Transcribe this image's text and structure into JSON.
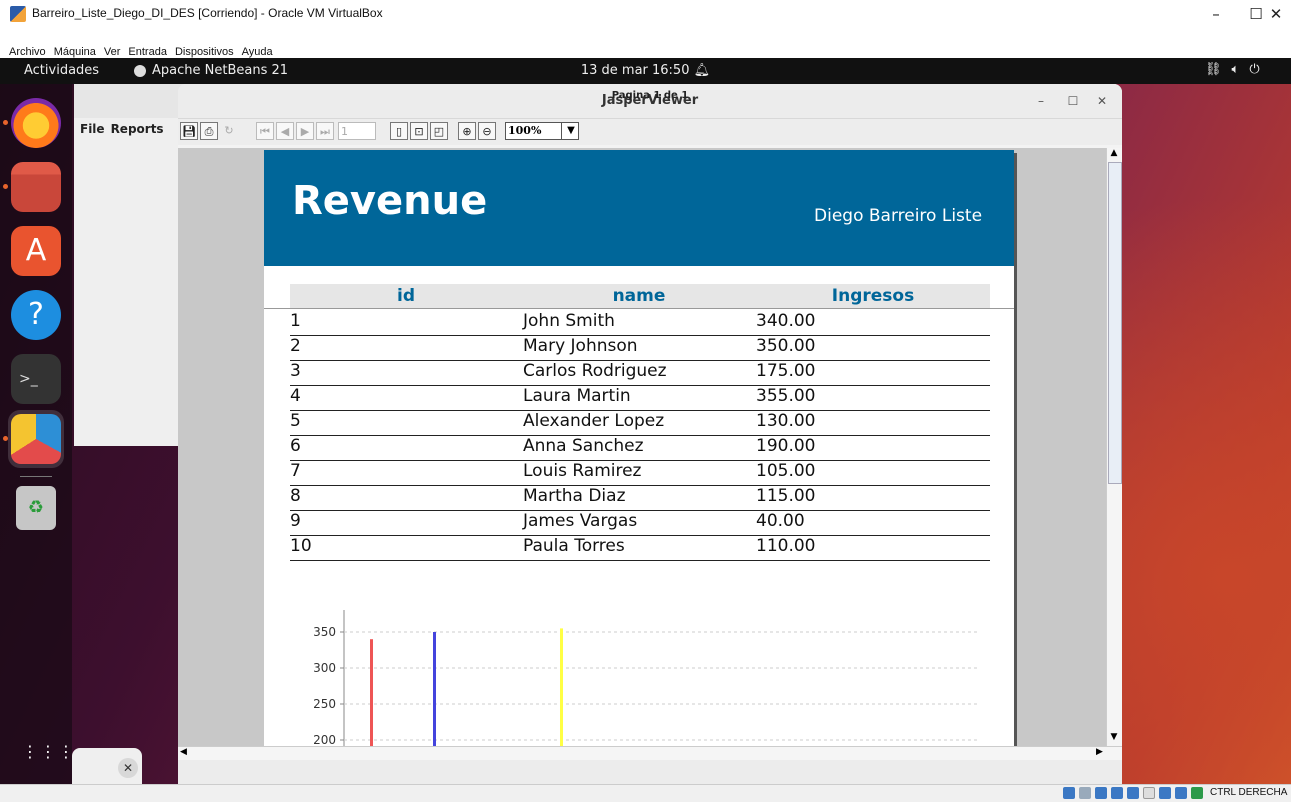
{
  "host": {
    "title": "Barreiro_Liste_Diego_DI_DES [Corriendo] - Oracle VM VirtualBox",
    "menus": [
      "Archivo",
      "Máquina",
      "Ver",
      "Entrada",
      "Dispositivos",
      "Ayuda"
    ],
    "statusbar_label": "CTRL DERECHA"
  },
  "gnome": {
    "activities": "Actividades",
    "app_name": "Apache NetBeans 21",
    "clock": "13 de mar  16:50"
  },
  "netbeans": {
    "menus": [
      "File",
      "Reports"
    ]
  },
  "viewer": {
    "title": "JasperViewer",
    "page_field": "1",
    "zoom": "100%",
    "status": "Pagina 1 de 1"
  },
  "report": {
    "title": "Revenue",
    "author": "Diego Barreiro Liste",
    "columns": [
      "id",
      "name",
      "Ingresos"
    ],
    "rows": [
      [
        "1",
        "John Smith",
        "340.00"
      ],
      [
        "2",
        "Mary Johnson",
        "350.00"
      ],
      [
        "3",
        "Carlos Rodriguez",
        "175.00"
      ],
      [
        "4",
        "Laura Martin",
        "355.00"
      ],
      [
        "5",
        "Alexander Lopez",
        "130.00"
      ],
      [
        "6",
        "Anna Sanchez",
        "190.00"
      ],
      [
        "7",
        "Louis Ramirez",
        "105.00"
      ],
      [
        "8",
        "Martha Diaz",
        "115.00"
      ],
      [
        "9",
        "James Vargas",
        "40.00"
      ],
      [
        "10",
        "Paula Torres",
        "110.00"
      ]
    ]
  },
  "chart_data": {
    "type": "bar",
    "title": "",
    "xlabel": "",
    "ylabel": "",
    "y_ticks": [
      200,
      250,
      300,
      350
    ],
    "ylim": [
      200,
      360
    ],
    "visible_bars": [
      {
        "value": 340,
        "color": "#ee5555"
      },
      {
        "value": 350,
        "color": "#4444dd"
      },
      {
        "value": 355,
        "color": "#ffff44"
      }
    ],
    "grid": true
  }
}
